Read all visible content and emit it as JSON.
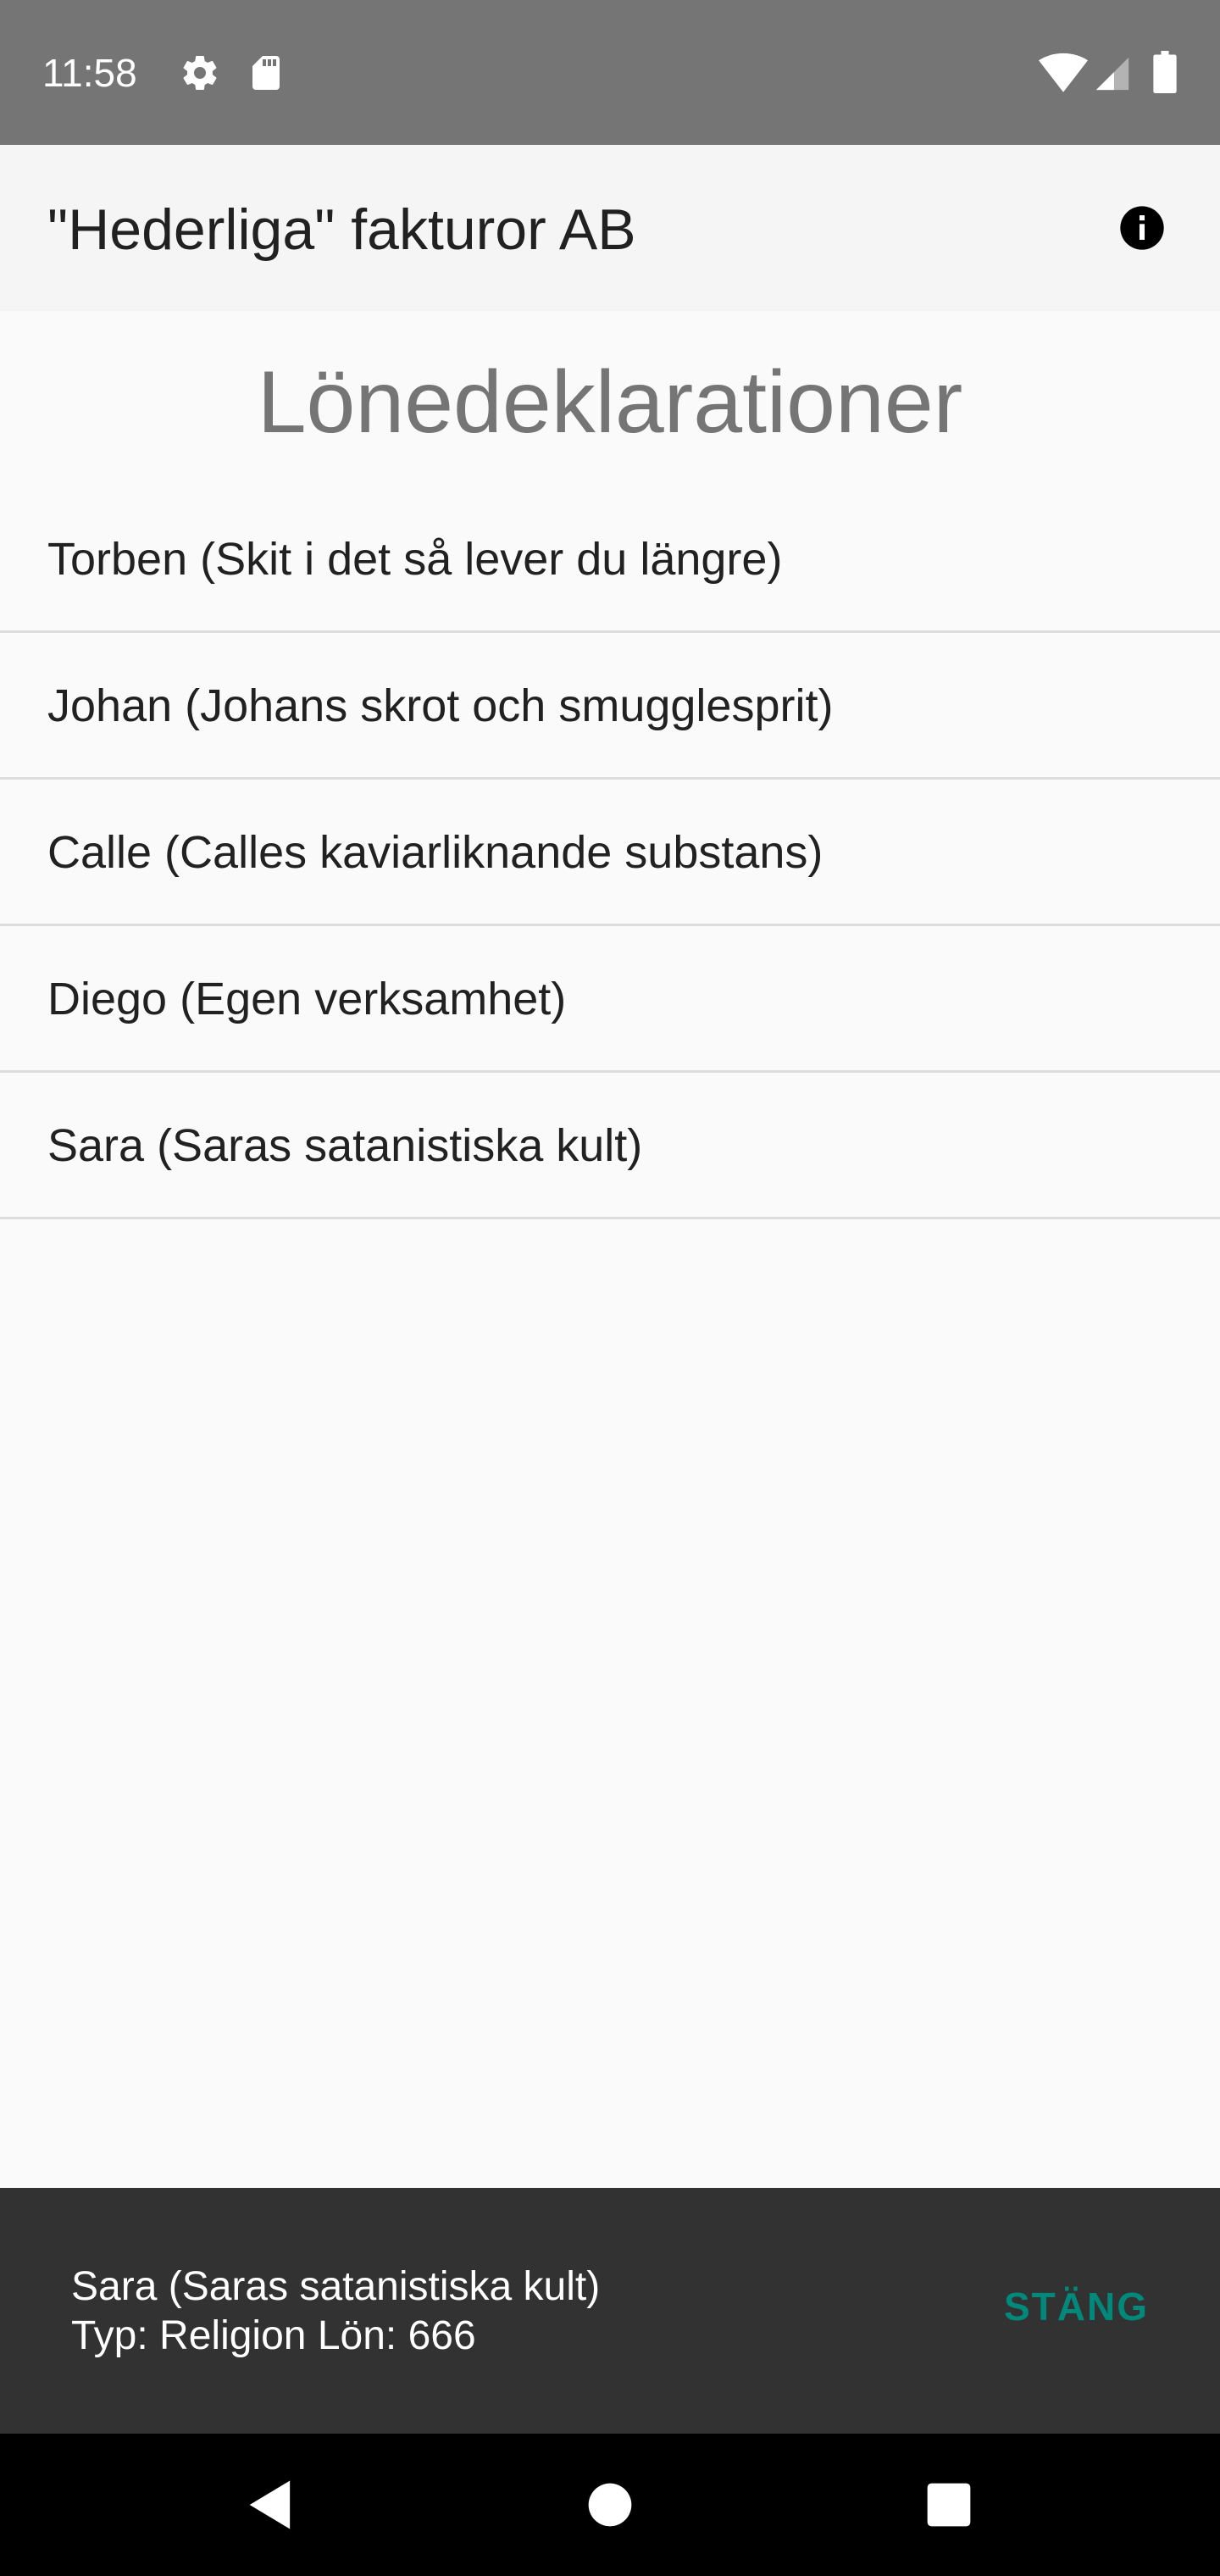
{
  "status_bar": {
    "time": "11:58",
    "icons": [
      "gear-icon",
      "sd-card-icon",
      "wifi-icon",
      "cellular-signal-icon",
      "battery-icon"
    ]
  },
  "app_bar": {
    "title": "\"Hederliga\" fakturor AB",
    "info_icon": "info-icon"
  },
  "main": {
    "heading": "Lönedeklarationer",
    "items": [
      {
        "label": "Torben (Skit i det så lever du längre)"
      },
      {
        "label": "Johan (Johans skrot och smugglesprit)"
      },
      {
        "label": "Calle (Calles kaviarliknande substans)"
      },
      {
        "label": "Diego (Egen verksamhet)"
      },
      {
        "label": "Sara (Saras satanistiska kult)"
      }
    ]
  },
  "snackbar": {
    "line1": "Sara (Saras satanistiska kult)",
    "line2": "Typ: Religion Lön: 666",
    "action_label": "STÄNG",
    "action_color": "#00897b"
  },
  "nav_bar": {
    "icons": [
      "back-icon",
      "home-icon",
      "recents-icon"
    ]
  },
  "colors": {
    "status_bar": "#757575",
    "app_bar": "#f5f5f5",
    "background": "#fafafa",
    "snackbar": "#323232",
    "nav_bar": "#000000"
  }
}
